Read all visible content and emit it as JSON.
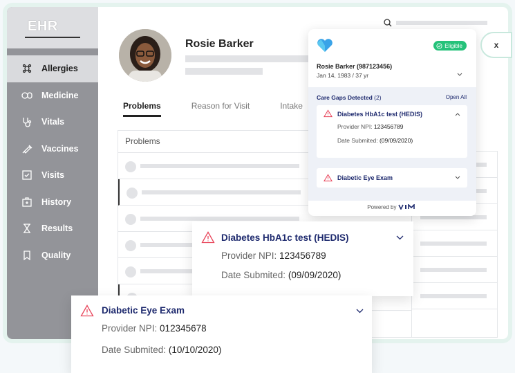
{
  "app": {
    "logo": "EHR"
  },
  "sidebar": {
    "items": [
      {
        "label": "Allergies",
        "icon": "allergies-icon",
        "active": true
      },
      {
        "label": "Medicine",
        "icon": "medicine-icon"
      },
      {
        "label": "Vitals",
        "icon": "stethoscope-icon"
      },
      {
        "label": "Vaccines",
        "icon": "syringe-icon"
      },
      {
        "label": "Visits",
        "icon": "checkbox-icon"
      },
      {
        "label": "History",
        "icon": "history-icon"
      },
      {
        "label": "Results",
        "icon": "results-icon"
      },
      {
        "label": "Quality",
        "icon": "bookmark-icon"
      }
    ]
  },
  "patient": {
    "name": "Rosie Barker"
  },
  "tabs": [
    "Problems",
    "Reason for Visit",
    "Intake"
  ],
  "problems_table": {
    "header": "Problems"
  },
  "vim": {
    "status": "Eligible",
    "patient_line": "Rosie Barker  (987123456)",
    "dob_line": "Jan 14, 1983  /  37 yr",
    "gaps_title": "Care Gaps Detected",
    "gaps_count": "(2)",
    "open_all": "Open All",
    "gaps": [
      {
        "title": "Diabetes HbA1c test (HEDIS)",
        "npi_label": "Provider NPI:",
        "npi": "123456789",
        "date_label": "Date Submited:",
        "date": "(09/09/2020)"
      },
      {
        "title": "Diabetic Eye Exam"
      }
    ],
    "powered_by": "Powered by"
  },
  "close_label": "x",
  "zoom": [
    {
      "title": "Diabetes HbA1c test (HEDIS)",
      "npi_label": "Provider NPI:",
      "npi": "123456789",
      "date_label": "Date Submited:",
      "date": "(09/09/2020)"
    },
    {
      "title": "Diabetic Eye Exam",
      "npi_label": "Provider NPI:",
      "npi": "012345678",
      "date_label": "Date Submited:",
      "date": "(10/10/2020)"
    }
  ],
  "colors": {
    "brand_navy": "#1e2a6e",
    "vim_blue": "#3aa3e8",
    "eligible_green": "#25c27a",
    "alert_red": "#e8445a"
  }
}
